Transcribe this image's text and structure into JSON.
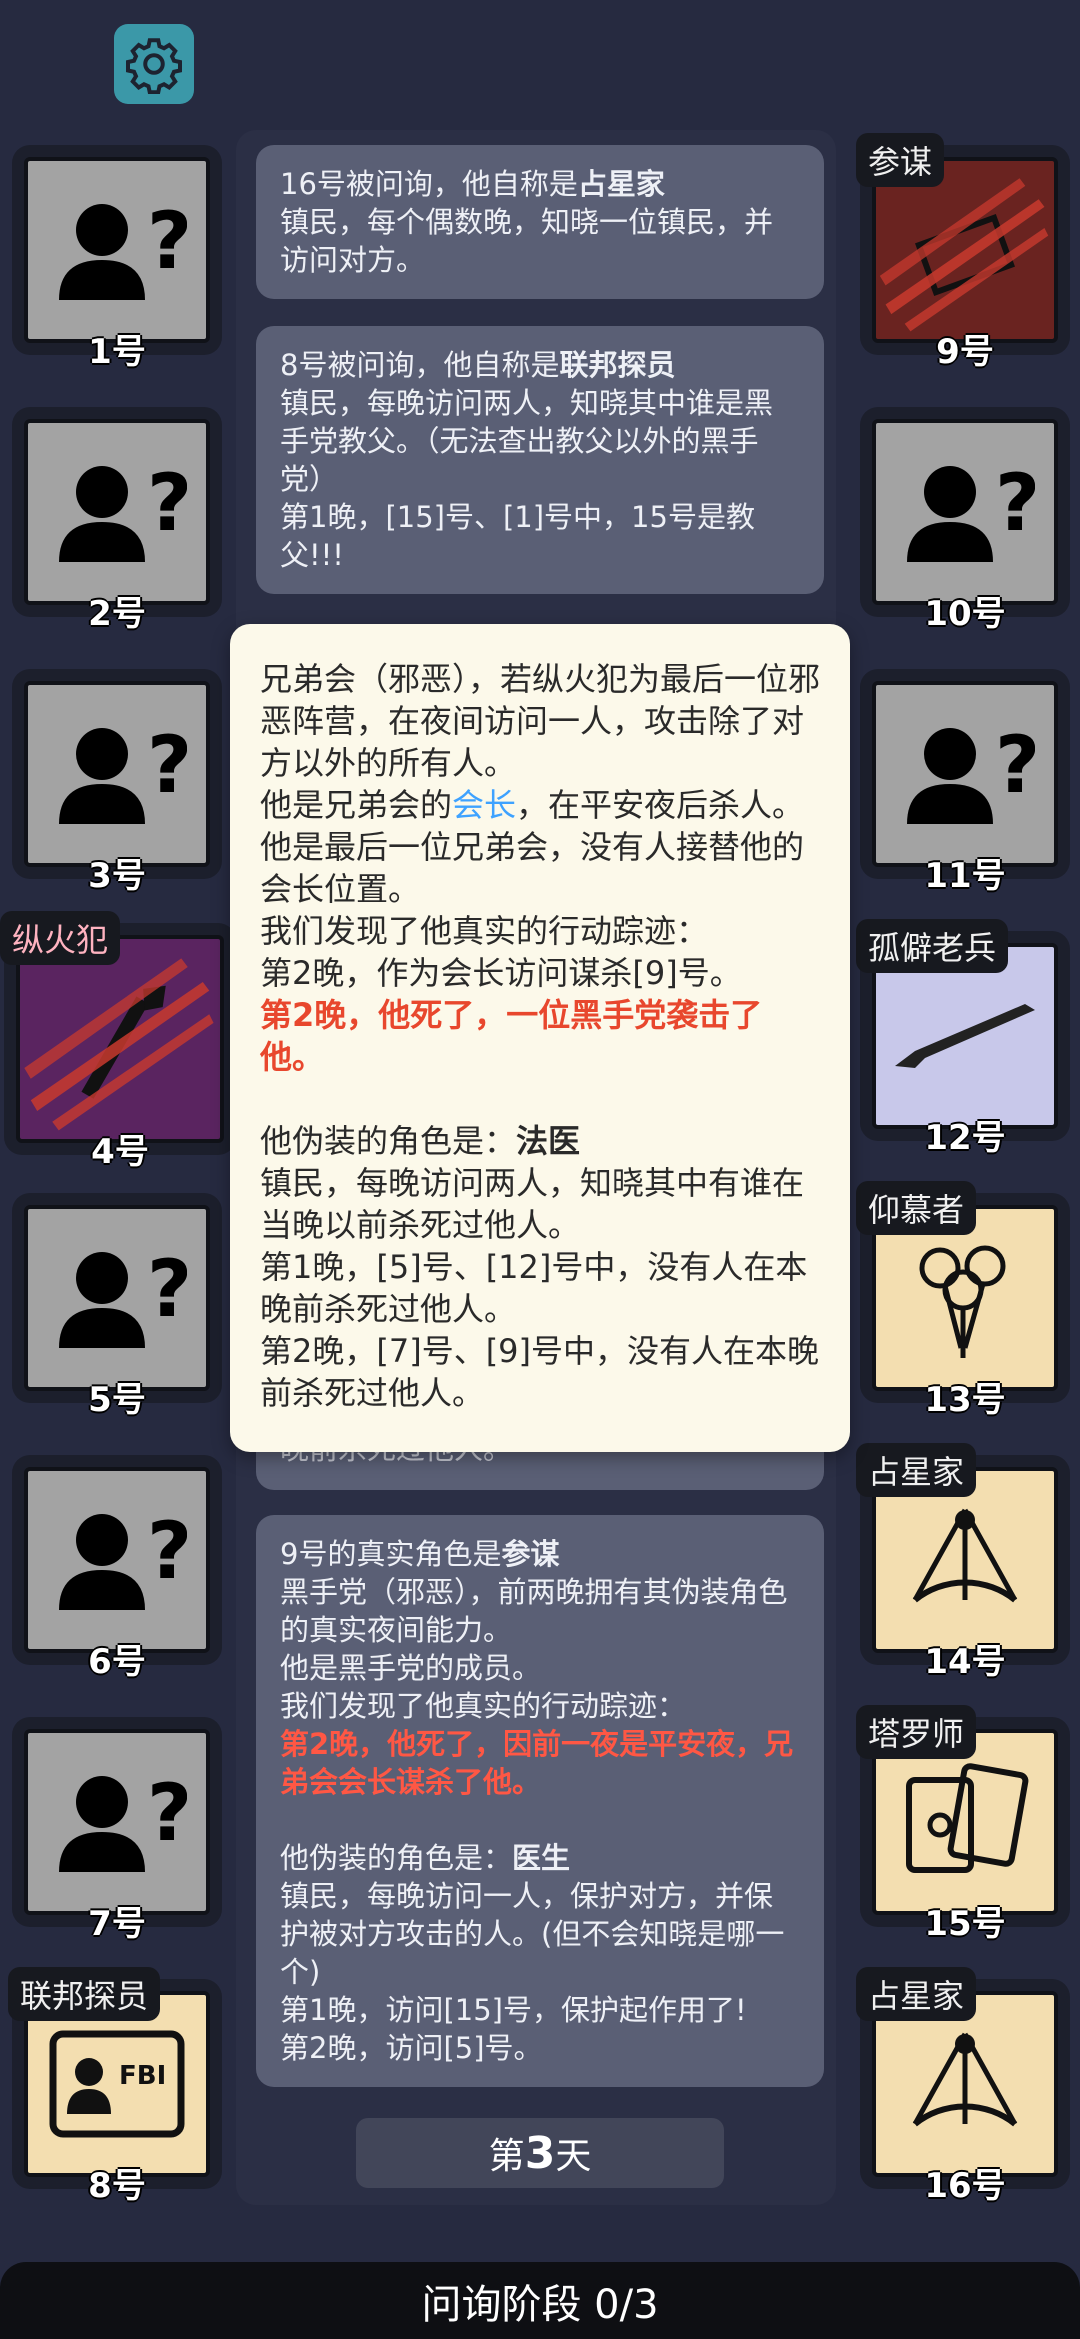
{
  "left_players": [
    {
      "number": "1号",
      "role": "",
      "face": "unknown"
    },
    {
      "number": "2号",
      "role": "",
      "face": "unknown"
    },
    {
      "number": "3号",
      "role": "",
      "face": "unknown"
    },
    {
      "number": "4号",
      "role": "纵火犯",
      "face": "purple"
    },
    {
      "number": "5号",
      "role": "",
      "face": "unknown"
    },
    {
      "number": "6号",
      "role": "",
      "face": "unknown"
    },
    {
      "number": "7号",
      "role": "",
      "face": "unknown"
    },
    {
      "number": "8号",
      "role": "联邦探员",
      "face": "tan"
    }
  ],
  "right_players": [
    {
      "number": "9号",
      "role": "参谋",
      "face": "red"
    },
    {
      "number": "10号",
      "role": "",
      "face": "unknown"
    },
    {
      "number": "11号",
      "role": "",
      "face": "unknown"
    },
    {
      "number": "12号",
      "role": "孤僻老兵",
      "face": "lavender"
    },
    {
      "number": "13号",
      "role": "仰慕者",
      "face": "tan"
    },
    {
      "number": "14号",
      "role": "占星家",
      "face": "tan"
    },
    {
      "number": "15号",
      "role": "塔罗师",
      "face": "tan"
    },
    {
      "number": "16号",
      "role": "占星家",
      "face": "tan"
    }
  ],
  "log": {
    "card1": {
      "intro": "16号被问询，他自称是",
      "role": "占星家",
      "desc": "镇民，每个偶数晚，知晓一位镇民，并访问对方。"
    },
    "card2": {
      "intro": "8号被问询，他自称是",
      "role": "联邦探员",
      "desc": "镇民，每晚访问两人，知晓其中谁是黑手党教父。（无法查出教父以外的黑手党）",
      "result": "第1晚，[15]号、[1]号中，15号是教父!!!"
    },
    "card3_peek": "晚前杀死过他人。",
    "card4": {
      "intro": "9号的真实角色是",
      "role": "参谋",
      "desc": "黑手党（邪恶），前两晚拥有其伪装角色的真实夜间能力。",
      "line2": "他是黑手党的成员。",
      "line3": "我们发现了他真实的行动踪迹：",
      "death": "第2晚，他死了，因前一夜是平安夜，兄弟会会长谋杀了他。",
      "disguise_intro": "他伪装的角色是：",
      "disguise_role": "医生",
      "disguise_desc": "镇民，每晚访问一人，保护对方，并保护被对方攻击的人。(但不会知晓是哪一个)",
      "night1": "第1晚，访问[15]号，保护起作用了!",
      "night2": "第2晚，访问[5]号。"
    }
  },
  "popup": {
    "desc": "兄弟会（邪恶），若纵火犯为最后一位邪恶阵营，在夜间访问一人，攻击除了对方以外的所有人。",
    "line2_a": "他是兄弟会的",
    "line2_link": "会长",
    "line2_b": "，在平安夜后杀人。他是最后一位兄弟会，没有人接替他的会长位置。",
    "line3": "我们发现了他真实的行动踪迹：",
    "line4": "第2晚，作为会长访问谋杀[9]号。",
    "death": "第2晚，他死了，一位黑手党袭击了他。",
    "disguise_intro": "他伪装的角色是：",
    "disguise_role": "法医",
    "disguise_desc": "镇民，每晚访问两人，知晓其中有谁在当晚以前杀死过他人。",
    "night1": "第1晚，[5]号、[12]号中，没有人在本晚前杀死过他人。",
    "night2": "第2晚，[7]号、[9]号中，没有人在本晚前杀死过他人。"
  },
  "day": {
    "prefix": "第",
    "number": "3",
    "suffix": "天"
  },
  "phase": "问询阶段 0/3",
  "colors": {
    "background": "#262a40",
    "card": "#5a5f75",
    "popup": "#fcf9ea",
    "accent_red": "#ff5744",
    "accent_blue": "#3ea2ff"
  }
}
